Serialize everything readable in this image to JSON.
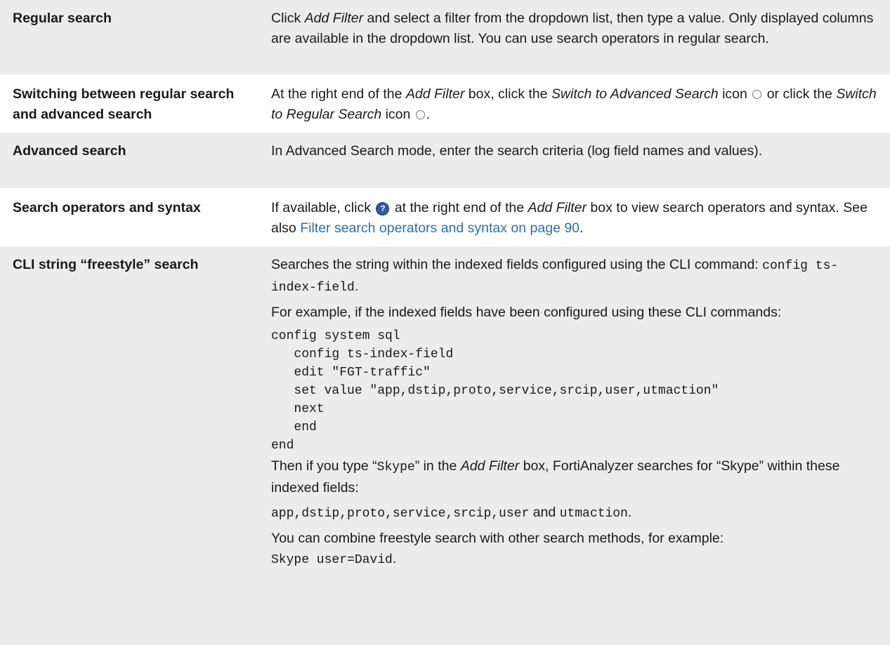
{
  "rows": [
    {
      "term": "Regular search",
      "desc": {
        "pre": "Click ",
        "em1": "Add Filter",
        "post": " and select a filter from the dropdown list, then type a value. Only displayed columns are available in the dropdown list. You can use search operators in regular search."
      }
    },
    {
      "term": "Switching between regular search and advanced search",
      "desc": {
        "t1": "At the right end of the ",
        "em1": "Add Filter",
        "t2": " box, click the ",
        "em2": "Switch to Advanced Search",
        "t3": " icon",
        "t4": " or click the ",
        "em3": "Switch to Regular Search",
        "t5": " icon",
        "t6": "."
      }
    },
    {
      "term": "Advanced search",
      "desc": {
        "text": "In Advanced Search mode, enter the search criteria (log field names and values)."
      }
    },
    {
      "term": "Search operators and syntax",
      "desc": {
        "t1": "If available, click ",
        "help_glyph": "?",
        "t2": " at the right end of the ",
        "em1": "Add Filter",
        "t3": " box to view search operators and syntax. See also ",
        "link": "Filter search operators and syntax on page 90",
        "t4": "."
      }
    },
    {
      "term": "CLI string “freestyle” search",
      "desc": {
        "p1_text": "Searches the string within the indexed fields configured using the CLI command: ",
        "p1_code": "config ts-index-field",
        "p1_end": ".",
        "p2": "For example, if the indexed fields have been configured using these CLI commands:",
        "code_lines": [
          "config system sql",
          "   config ts-index-field",
          "   edit \"FGT-traffic\"",
          "   set value \"app,dstip,proto,service,srcip,user,utmaction\"",
          "   next",
          "   end",
          "end"
        ],
        "p3_t1": "Then if you type “",
        "p3_code": "Skype",
        "p3_t2": "” in the ",
        "p3_em": "Add Filter",
        "p3_t3": " box, FortiAnalyzer searches for “Skype” within these indexed fields:",
        "p4_code1": "app,dstip,proto,service,srcip,user",
        "p4_t": " and ",
        "p4_code2": "utmaction",
        "p4_end": ".",
        "p5": "You can combine freestyle search with other search methods, for example:",
        "p6_code": "Skype user=David",
        "p6_end": "."
      }
    }
  ]
}
